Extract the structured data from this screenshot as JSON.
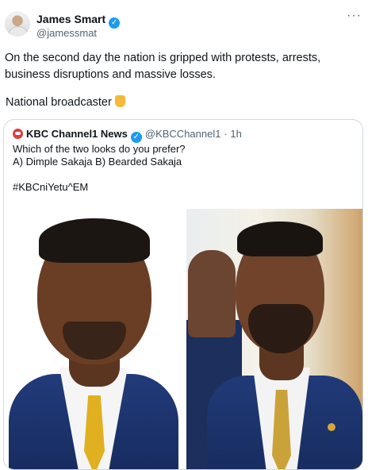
{
  "tweet": {
    "author_name": "James Smart",
    "author_handle": "@jamessmat",
    "verified_mark": "✓",
    "more_label": "···",
    "text": "On the second day the nation is gripped with protests, arrests, business disruptions and massive losses.",
    "text2": "National broadcaster"
  },
  "quote": {
    "name": "KBC Channel1 News",
    "handle": "@KBCChannel1",
    "time": "· 1h",
    "line1": "Which of the two looks do you prefer?",
    "line2": "A) Dimple Sakaja  B) Bearded Sakaja",
    "hashtag": "#KBCniYetu^EM"
  },
  "icons": {
    "avatar": "profile-avatar",
    "verified": "verified-badge-icon",
    "more": "more-dots-icon",
    "emoji": "pointing-down-emoji",
    "logo": "kbc-logo-icon"
  },
  "colors": {
    "verified": "#1d9bf0",
    "secondary_text": "#536471",
    "border": "#cfd9de"
  }
}
